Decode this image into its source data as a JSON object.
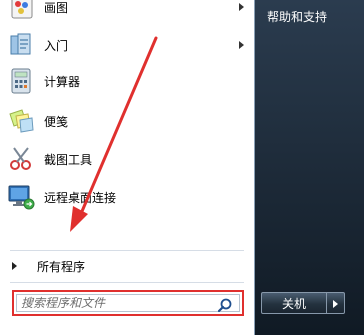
{
  "programs": [
    {
      "label": "画图",
      "icon": "paint-icon",
      "has_submenu": true
    },
    {
      "label": "入门",
      "icon": "getting-started-icon",
      "has_submenu": true
    },
    {
      "label": "计算器",
      "icon": "calculator-icon",
      "has_submenu": false
    },
    {
      "label": "便笺",
      "icon": "sticky-notes-icon",
      "has_submenu": false
    },
    {
      "label": "截图工具",
      "icon": "snipping-tool-icon",
      "has_submenu": false
    },
    {
      "label": "远程桌面连接",
      "icon": "remote-desktop-icon",
      "has_submenu": false
    }
  ],
  "all_programs_label": "所有程序",
  "search": {
    "placeholder": "搜索程序和文件"
  },
  "right_pane": {
    "help_label": "帮助和支持"
  },
  "shutdown": {
    "label": "关机"
  },
  "colors": {
    "highlight": "#e0302e",
    "right_pane": "#1c2a38"
  }
}
